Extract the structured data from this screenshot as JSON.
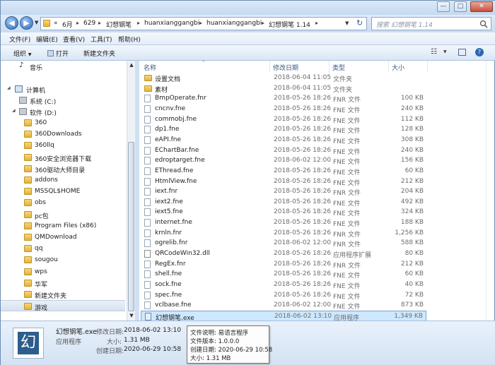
{
  "window": {
    "minimize": "—",
    "maximize": "□",
    "close": "✕"
  },
  "address": {
    "prefix": "«",
    "crumbs": [
      "6月",
      "629",
      "幻想钢笔",
      "huanxianggangbi",
      "huanxianggangbi",
      "幻想钢笔 1.14"
    ],
    "search_placeholder": "搜索 幻想钢笔 1.14"
  },
  "menu": [
    "文件(F)",
    "编辑(E)",
    "查看(V)",
    "工具(T)",
    "帮助(H)"
  ],
  "toolbar": {
    "organize": "组织",
    "open": "打开",
    "new_folder": "新建文件夹"
  },
  "nav": {
    "music": "音乐",
    "computer": "计算机",
    "drive_c": "系统 (C:)",
    "drive_d": "软件 (D:)",
    "folders": [
      "360",
      "360Downloads",
      "360llq",
      "360安全浏览器下载",
      "360驱动大师目录",
      "addons",
      "MSSQL$HOME",
      "obs",
      "pc包",
      "Program Files (x86)",
      "QMDownload",
      "qq",
      "sougou",
      "wps",
      "华军",
      "新建文件夹",
      "游戏"
    ]
  },
  "columns": {
    "name": "名称",
    "modified": "修改日期",
    "type": "类型",
    "size": "大小"
  },
  "files": [
    {
      "name": "设置文档",
      "date": "2018-06-04 11:05",
      "type": "文件夹",
      "size": "",
      "icon": "folder"
    },
    {
      "name": "素材",
      "date": "2018-06-04 11:05",
      "type": "文件夹",
      "size": "",
      "icon": "folder"
    },
    {
      "name": "BmpOperate.fnr",
      "date": "2018-05-26 18:26",
      "type": "FNR 文件",
      "size": "100 KB",
      "icon": "doc"
    },
    {
      "name": "cncnv.fne",
      "date": "2018-05-26 18:26",
      "type": "FNE 文件",
      "size": "240 KB",
      "icon": "doc"
    },
    {
      "name": "commobj.fne",
      "date": "2018-05-26 18:26",
      "type": "FNE 文件",
      "size": "112 KB",
      "icon": "doc"
    },
    {
      "name": "dp1.fne",
      "date": "2018-05-26 18:26",
      "type": "FNE 文件",
      "size": "128 KB",
      "icon": "doc"
    },
    {
      "name": "eAPI.fne",
      "date": "2018-05-26 18:26",
      "type": "FNE 文件",
      "size": "308 KB",
      "icon": "doc"
    },
    {
      "name": "EChartBar.fne",
      "date": "2018-05-26 18:26",
      "type": "FNE 文件",
      "size": "240 KB",
      "icon": "doc"
    },
    {
      "name": "edroptarget.fne",
      "date": "2018-06-02 12:00",
      "type": "FNE 文件",
      "size": "156 KB",
      "icon": "doc"
    },
    {
      "name": "EThread.fne",
      "date": "2018-05-26 18:26",
      "type": "FNE 文件",
      "size": "60 KB",
      "icon": "doc"
    },
    {
      "name": "HtmlView.fne",
      "date": "2018-05-26 18:26",
      "type": "FNE 文件",
      "size": "212 KB",
      "icon": "doc"
    },
    {
      "name": "iext.fnr",
      "date": "2018-05-26 18:26",
      "type": "FNR 文件",
      "size": "204 KB",
      "icon": "doc"
    },
    {
      "name": "iext2.fne",
      "date": "2018-05-26 18:26",
      "type": "FNE 文件",
      "size": "492 KB",
      "icon": "doc"
    },
    {
      "name": "iext5.fne",
      "date": "2018-05-26 18:26",
      "type": "FNE 文件",
      "size": "324 KB",
      "icon": "doc"
    },
    {
      "name": "internet.fne",
      "date": "2018-05-26 18:26",
      "type": "FNE 文件",
      "size": "188 KB",
      "icon": "doc"
    },
    {
      "name": "krnln.fnr",
      "date": "2018-05-26 18:26",
      "type": "FNR 文件",
      "size": "1,256 KB",
      "icon": "doc"
    },
    {
      "name": "ogrelib.fnr",
      "date": "2018-06-02 12:00",
      "type": "FNR 文件",
      "size": "588 KB",
      "icon": "doc"
    },
    {
      "name": "QRCodeWin32.dll",
      "date": "2018-05-26 18:26",
      "type": "应用程序扩展",
      "size": "80 KB",
      "icon": "dll"
    },
    {
      "name": "RegEx.fnr",
      "date": "2018-05-26 18:26",
      "type": "FNR 文件",
      "size": "212 KB",
      "icon": "doc"
    },
    {
      "name": "shell.fne",
      "date": "2018-05-26 18:26",
      "type": "FNE 文件",
      "size": "60 KB",
      "icon": "doc"
    },
    {
      "name": "sock.fne",
      "date": "2018-05-26 18:26",
      "type": "FNE 文件",
      "size": "40 KB",
      "icon": "doc"
    },
    {
      "name": "spec.fne",
      "date": "2018-05-26 18:26",
      "type": "FNE 文件",
      "size": "72 KB",
      "icon": "doc"
    },
    {
      "name": "vclbase.fne",
      "date": "2018-06-02 12:00",
      "type": "FNE 文件",
      "size": "873 KB",
      "icon": "doc"
    },
    {
      "name": "幻想钢笔.exe",
      "date": "2018-06-02 13:10",
      "type": "应用程序",
      "size": "1,349 KB",
      "icon": "exe",
      "selected": true
    }
  ],
  "details": {
    "icon_glyph": "幻",
    "filename": "幻想钢笔.exe",
    "filetype": "应用程序",
    "modified_label": "修改日期:",
    "modified_value": "2018-06-02 13:10",
    "size_label": "大小:",
    "size_value": "1.31 MB",
    "created_label": "创建日期:",
    "created_value": "2020-06-29 10:58"
  },
  "tooltip": {
    "desc": "文件说明: 易语言程序",
    "version": "文件版本: 1.0.0.0",
    "created": "创建日期: 2020-06-29 10:58",
    "size": "大小: 1.31 MB"
  }
}
